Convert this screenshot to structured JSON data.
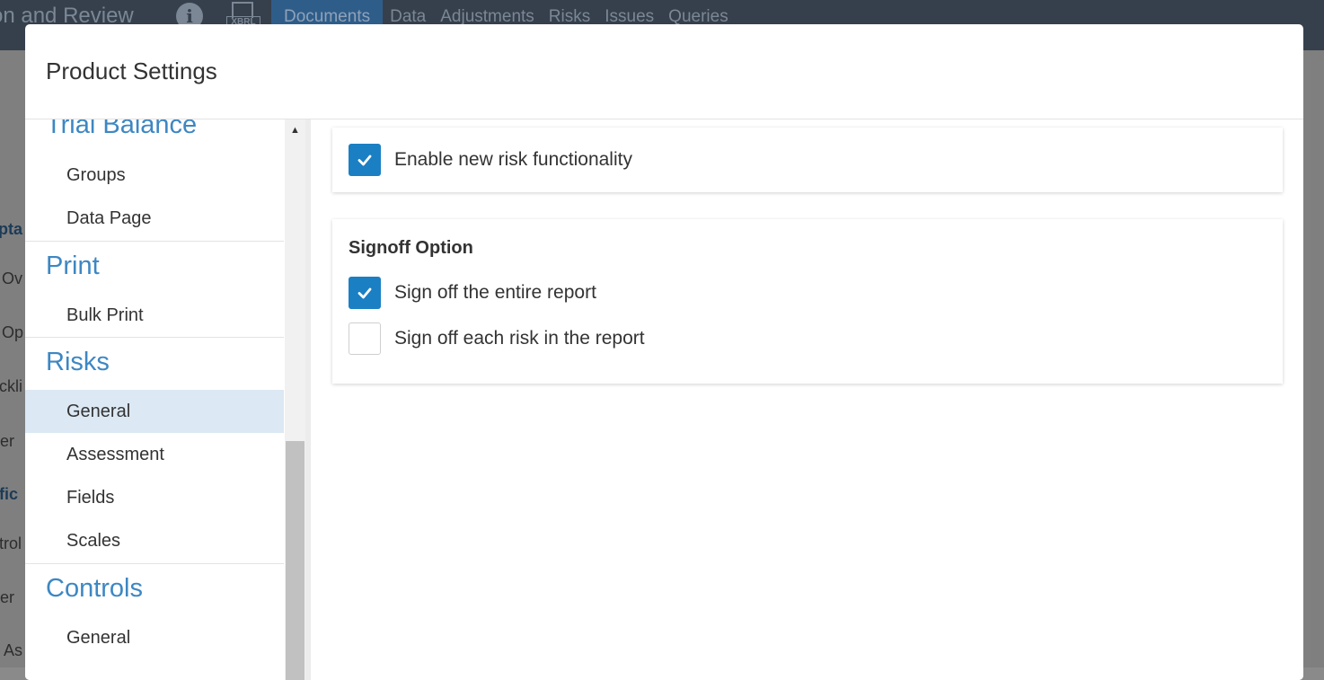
{
  "background": {
    "title": "on and Review",
    "nav_items": [
      "Documents",
      "Data",
      "Adjustments",
      "Risks",
      "Issues",
      "Queries"
    ],
    "xbrl_label": "XBRL",
    "left_fragments": [
      "pta",
      "Ov",
      "Op",
      "ckli",
      "er",
      "fic",
      "trol",
      "er",
      "As"
    ]
  },
  "modal": {
    "title": "Product Settings"
  },
  "sidebar": {
    "sections": [
      {
        "title": "Trial Balance",
        "items": [
          "Groups",
          "Data Page"
        ]
      },
      {
        "title": "Print",
        "items": [
          "Bulk Print"
        ]
      },
      {
        "title": "Risks",
        "items": [
          "General",
          "Assessment",
          "Fields",
          "Scales"
        ],
        "active_item": "General"
      },
      {
        "title": "Controls",
        "items": [
          "General"
        ]
      }
    ]
  },
  "content": {
    "enable_card": {
      "label": "Enable new risk functionality",
      "checked": true
    },
    "signoff_card": {
      "title": "Signoff Option",
      "options": [
        {
          "label": "Sign off the entire report",
          "checked": true
        },
        {
          "label": "Sign off each risk in the report",
          "checked": false
        }
      ]
    }
  },
  "colors": {
    "accent": "#1b7fc4",
    "section_title": "#3d87c3",
    "active_item_bg": "#dce8f3"
  }
}
